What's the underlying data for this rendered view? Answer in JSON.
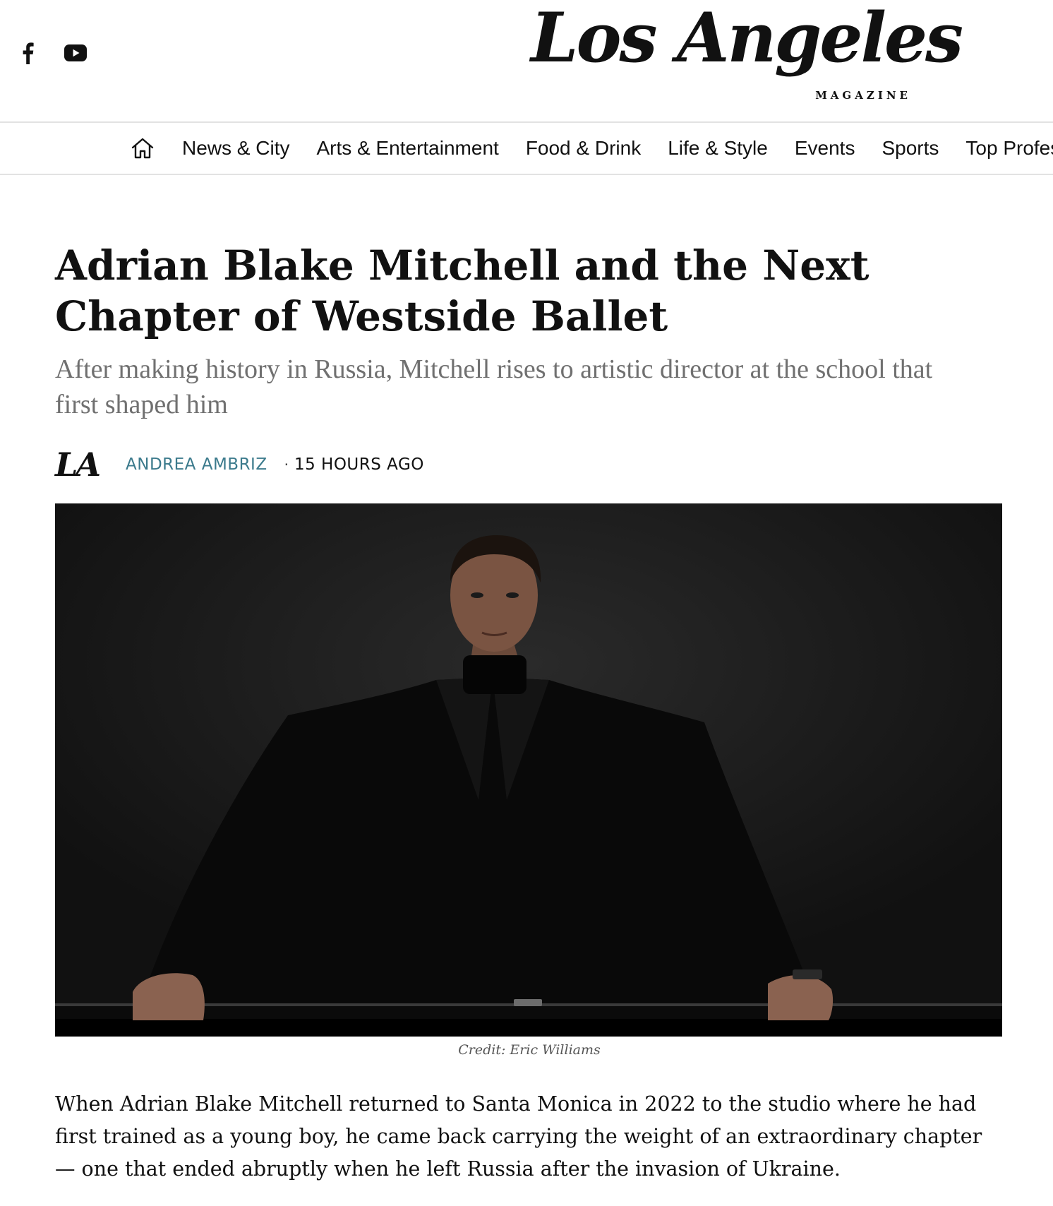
{
  "header": {
    "social": [
      {
        "icon": "facebook-icon"
      },
      {
        "icon": "youtube-icon"
      }
    ],
    "logo_text": "Los Angeles",
    "logo_sub": "MAGAZINE"
  },
  "nav": {
    "home_icon": "home-icon",
    "items": [
      {
        "label": "News & City"
      },
      {
        "label": "Arts & Entertainment"
      },
      {
        "label": "Food & Drink"
      },
      {
        "label": "Life & Style"
      },
      {
        "label": "Events"
      },
      {
        "label": "Sports"
      },
      {
        "label": "Top Professi"
      }
    ]
  },
  "article": {
    "title": "Adrian Blake Mitchell and the Next Chapter of Westside Ballet",
    "subtitle": "After making history in Russia, Mitchell rises to artistic director at the school that first shaped him",
    "byline": {
      "logo_mark": "LA",
      "author": "ANDREA AMBRIZ",
      "separator": "·",
      "time": "15 HOURS AGO"
    },
    "image_credit": "Credit: Eric Williams",
    "body": "When Adrian Blake Mitchell returned to Santa Monica in 2022 to the studio where he had first trained as a young boy, he came back carrying the weight of an extraordinary chapter — one that ended abruptly when he left Russia after the invasion of Ukraine."
  },
  "colors": {
    "author_link": "#3b7a8c",
    "subtitle": "#707070",
    "divider": "#e2e2e2"
  }
}
